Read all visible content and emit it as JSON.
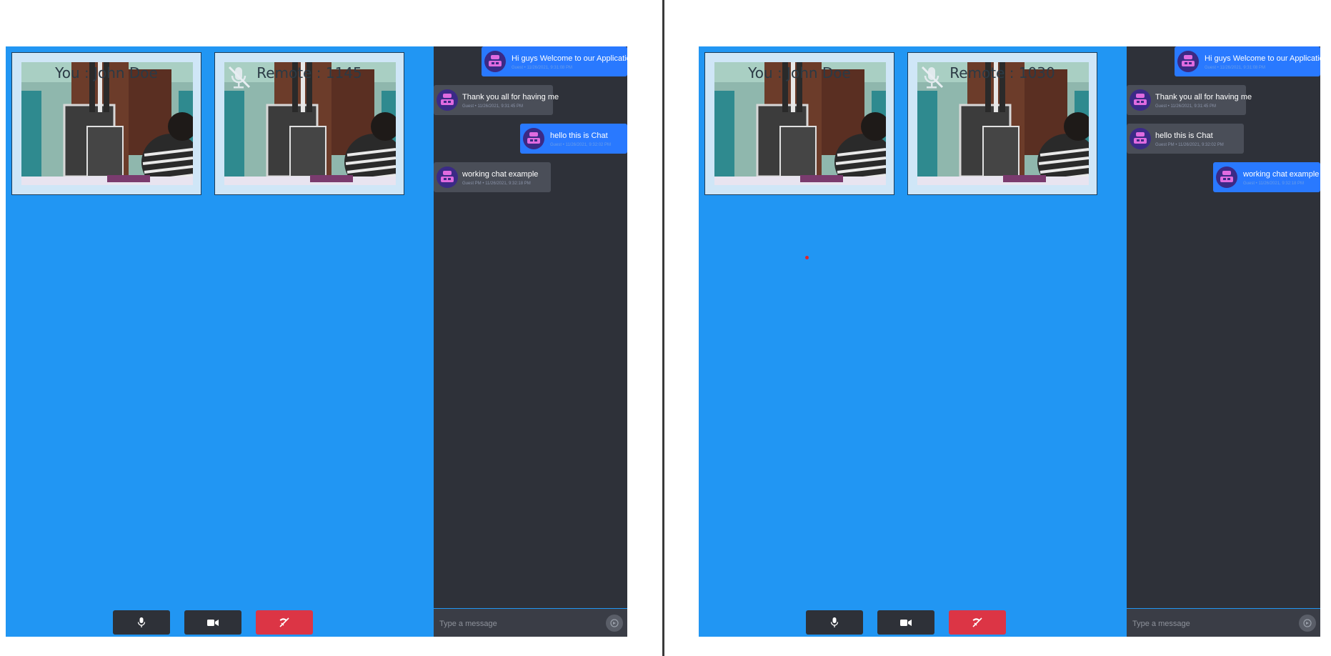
{
  "colors": {
    "app_bg": "#2196f3",
    "chat_bg": "#2e3139",
    "own_bubble": "#2979ff",
    "other_bubble": "#4a4e58",
    "control_bg": "#2e3138",
    "hangup_bg": "#dc3545"
  },
  "windows": [
    {
      "local_tile": {
        "label": "You : John Doe"
      },
      "remote_tile": {
        "label": "Remote : 1145",
        "mute_icon": "mic-off-icon"
      },
      "controls": {
        "mic_icon": "microphone-icon",
        "camera_icon": "video-camera-icon",
        "hangup_icon": "phone-hangup-icon"
      },
      "chat": {
        "messages": [
          {
            "side": "mine",
            "text": "Hi guys Welcome to our Application",
            "meta": "Guest • 11/26/2021, 9:31:08 PM"
          },
          {
            "side": "theirs",
            "text": "Thank you all for having me",
            "meta": "Guest • 11/26/2021, 9:31:45 PM"
          },
          {
            "side": "mine",
            "text": "hello this is Chat",
            "meta": "Guest • 11/26/2021, 9:32:02 PM"
          },
          {
            "side": "theirs",
            "text": "working chat example",
            "meta": "Guest PM • 11/26/2021, 9:32:18 PM"
          }
        ],
        "input_placeholder": "Type a message",
        "send_icon": "send-icon"
      }
    },
    {
      "local_tile": {
        "label": "You : John Doe"
      },
      "remote_tile": {
        "label": "Remote : 1030",
        "mute_icon": "mic-off-icon"
      },
      "controls": {
        "mic_icon": "microphone-icon",
        "camera_icon": "video-camera-icon",
        "hangup_icon": "phone-hangup-icon"
      },
      "chat": {
        "messages": [
          {
            "side": "mine",
            "text": "Hi guys Welcome to our Application",
            "meta": "Guest • 11/26/2021, 9:31:08 PM"
          },
          {
            "side": "theirs",
            "text": "Thank you all for having me",
            "meta": "Guest • 11/26/2021, 9:31:45 PM"
          },
          {
            "side": "theirs",
            "text": "hello this is Chat",
            "meta": "Guest PM • 11/26/2021, 9:32:02 PM"
          },
          {
            "side": "mine",
            "text": "working chat example",
            "meta": "Guest • 11/26/2021, 9:32:18 PM"
          }
        ],
        "input_placeholder": "Type a message",
        "send_icon": "send-icon"
      }
    }
  ]
}
